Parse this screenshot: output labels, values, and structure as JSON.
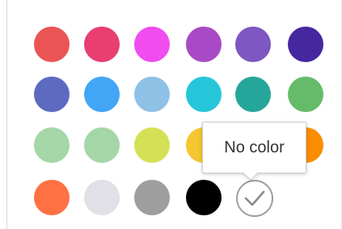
{
  "palette": {
    "swatches": [
      {
        "color": "#ea5455"
      },
      {
        "color": "#e83e72"
      },
      {
        "color": "#f04cf0"
      },
      {
        "color": "#a84ac5"
      },
      {
        "color": "#7e57c2"
      },
      {
        "color": "#4527a0"
      },
      {
        "color": "#5c6bc0"
      },
      {
        "color": "#42a5f5"
      },
      {
        "color": "#8ec1e6"
      },
      {
        "color": "#26c6da"
      },
      {
        "color": "#26a69a"
      },
      {
        "color": "#66bb6a"
      },
      {
        "color": "#a5d6a7"
      },
      {
        "color": "#a5d6a7"
      },
      {
        "color": "#d4e157"
      },
      {
        "color": "#f5c62f"
      },
      {
        "color": "#ffb300"
      },
      {
        "color": "#fb8c00"
      },
      {
        "color": "#ff7043"
      },
      {
        "color": "#e0e0e6"
      },
      {
        "color": "#9e9e9e"
      },
      {
        "color": "#000000"
      }
    ],
    "no_color": {
      "icon": "check-icon",
      "border_color": "#9e9e9e"
    }
  },
  "tooltip": {
    "text": "No color"
  }
}
